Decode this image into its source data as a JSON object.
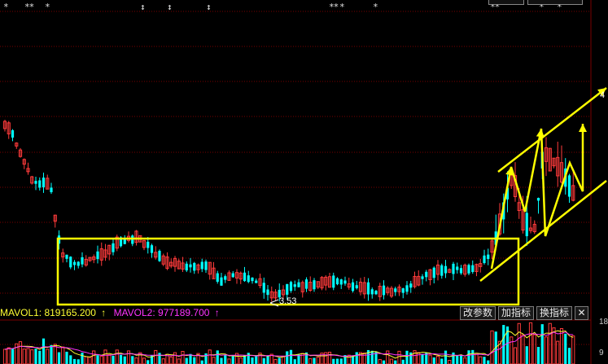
{
  "chart_data": {
    "type": "candlestick",
    "price_annotation": "3.53",
    "price_axis_label": "4",
    "volume": {
      "indicator": "MAVOL",
      "mavol1_label": "MAVOL1: 819165.200",
      "mavol2_label": "MAVOL2: 977189.700",
      "mavol1": 819165.2,
      "mavol2": 977189.7,
      "axis_labels": [
        "18",
        "9"
      ]
    },
    "colors": {
      "up": "#ff3b3b",
      "down": "#00ffff",
      "annotation": "#ffff00",
      "mavol1": "#ffff33",
      "mavol2": "#ff33ff",
      "grid": "#7a0000"
    },
    "marks": [
      "*",
      "**",
      "*",
      "↕",
      "↕",
      "↕",
      "**",
      "*",
      "*",
      "**",
      "*",
      "*"
    ]
  },
  "panel_buttons": {
    "modify_params": "改参数",
    "add_indicator": "加指标",
    "switch_indicator": "换指标",
    "close": "✕"
  },
  "glyph_up_arrow": "↑"
}
